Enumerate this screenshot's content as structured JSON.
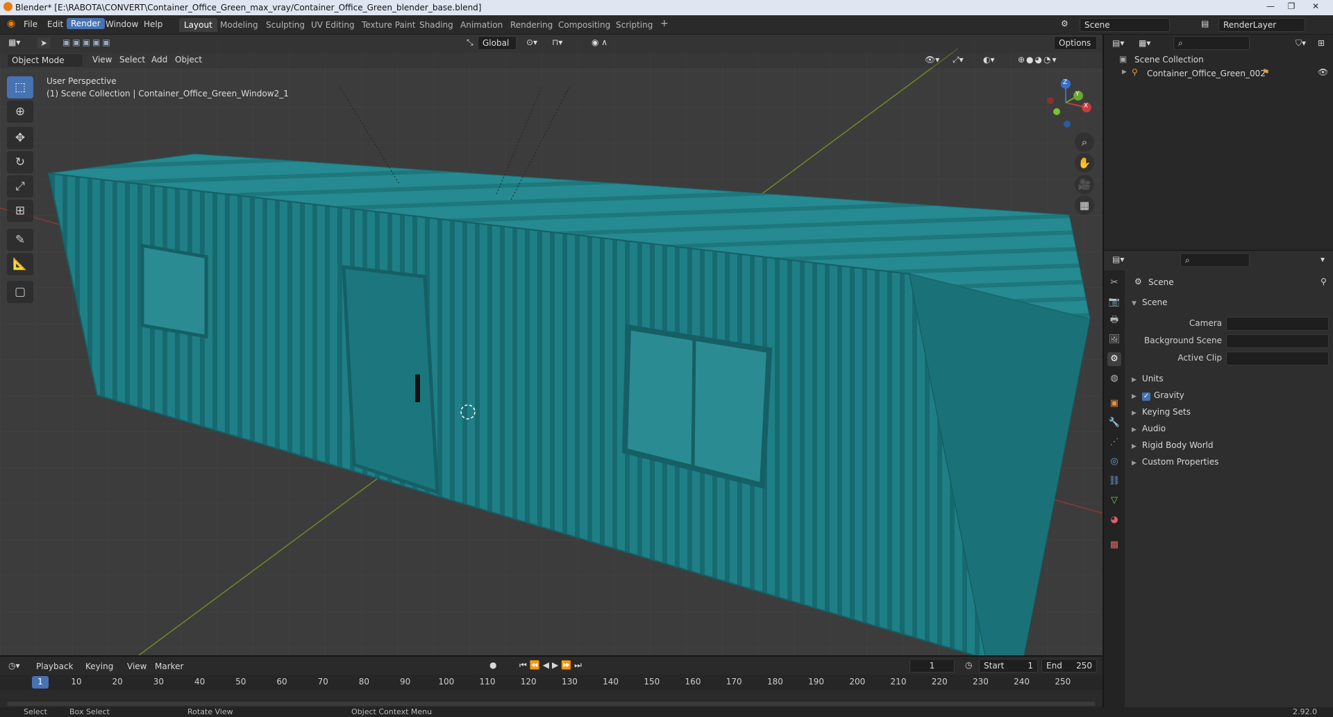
{
  "window": {
    "title": "Blender* [E:\\RABOTA\\CONVERT\\Container_Office_Green_max_vray/Container_Office_Green_blender_base.blend]",
    "min": "—",
    "max": "❐",
    "close": "✕"
  },
  "menu": {
    "items": [
      "File",
      "Edit",
      "Render",
      "Window",
      "Help"
    ],
    "active": "Render"
  },
  "workspaces": {
    "tabs": [
      "Layout",
      "Modeling",
      "Sculpting",
      "UV Editing",
      "Texture Paint",
      "Shading",
      "Animation",
      "Rendering",
      "Compositing",
      "Scripting"
    ],
    "active": "Layout",
    "add": "+"
  },
  "top_right": {
    "scene": "Scene",
    "view_layer": "RenderLayer"
  },
  "viewport_header": {
    "orientation": "Global",
    "options": "Options",
    "mode": "Object Mode",
    "menus": [
      "View",
      "Select",
      "Add",
      "Object"
    ]
  },
  "viewport": {
    "perspective": "User Perspective",
    "collection_line": "(1) Scene Collection | Container_Office_Green_Window2_1",
    "gizmo": {
      "x": "X",
      "y": "Y",
      "z": "Z"
    }
  },
  "outliner": {
    "root": "Scene Collection",
    "item": "Container_Office_Green_002"
  },
  "properties": {
    "breadcrumb": "Scene",
    "panel": "Scene",
    "fields": [
      {
        "label": "Camera"
      },
      {
        "label": "Background Scene"
      },
      {
        "label": "Active Clip"
      }
    ],
    "sections": [
      "Units",
      "Gravity",
      "Keying Sets",
      "Audio",
      "Rigid Body World",
      "Custom Properties"
    ],
    "gravity_checked": true
  },
  "timeline": {
    "menus": [
      "Playback",
      "Keying",
      "View",
      "Marker"
    ],
    "current_frame": "1",
    "start_label": "Start",
    "start": "1",
    "end_label": "End",
    "end": "250",
    "ticks": [
      "1",
      "10",
      "20",
      "30",
      "40",
      "50",
      "60",
      "70",
      "80",
      "90",
      "100",
      "110",
      "120",
      "130",
      "140",
      "150",
      "160",
      "170",
      "180",
      "190",
      "200",
      "210",
      "220",
      "230",
      "240",
      "250"
    ]
  },
  "status": {
    "items": [
      "Select",
      "Box Select",
      "Rotate View",
      "Object Context Menu"
    ],
    "version": "2.92.0"
  },
  "colors": {
    "container": "#1d7a80",
    "accent": "#4772b3"
  }
}
